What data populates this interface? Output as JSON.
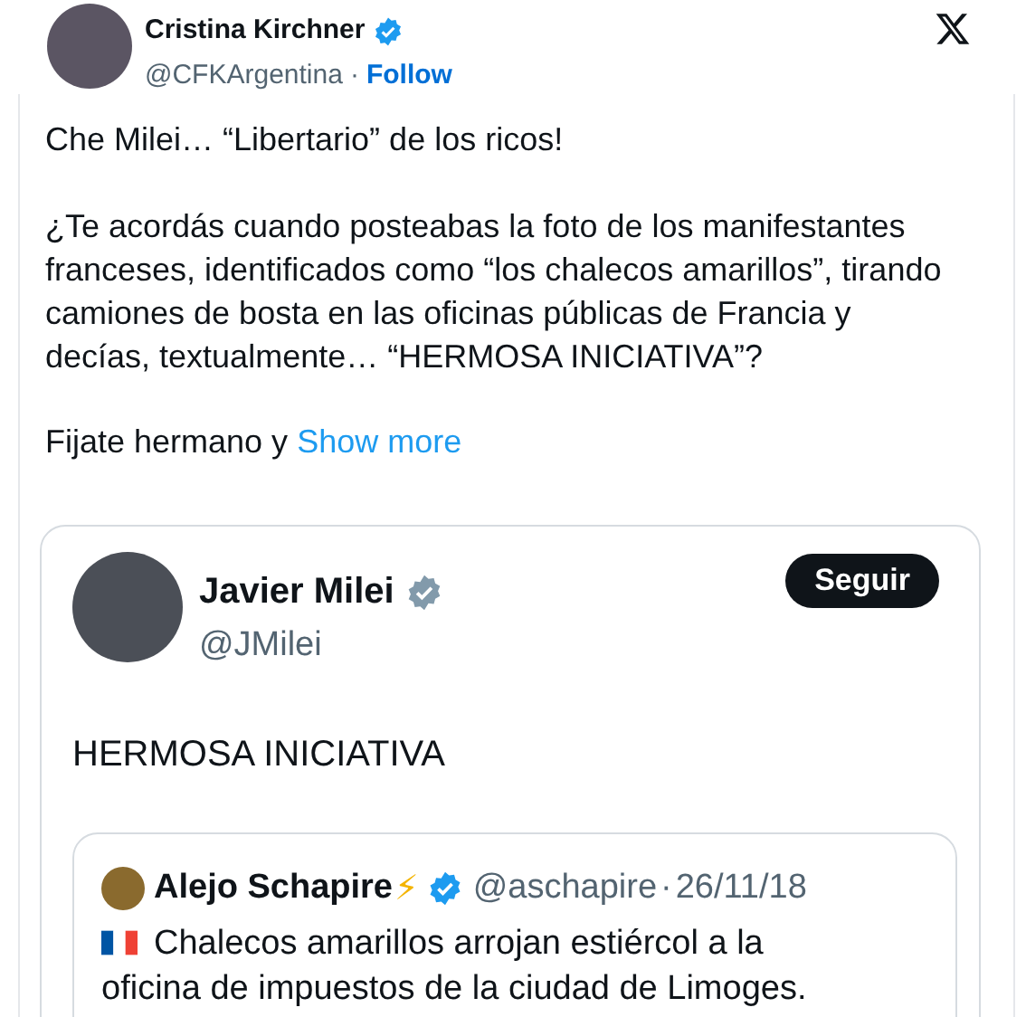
{
  "author": {
    "name": "Cristina Kirchner",
    "verified": true,
    "handle": "@CFKArgentina",
    "separator": "·",
    "follow": "Follow"
  },
  "text": [
    "Che Milei… “Libertario” de los ricos!",
    "¿Te acordás cuando posteabas la foto de los manifestantes franceses, identificados como “los chalecos amarillos”, tirando camiones de bosta en las oficinas públicas de Francia y decías, textualmente… “HERMOSA INICIATIVA”?"
  ],
  "teaser": {
    "text": "Fijate hermano y",
    "show_more": "Show more"
  },
  "embedded": {
    "author": {
      "name": "Javier Milei",
      "verified": true,
      "handle": "@JMilei"
    },
    "follow": "Seguir",
    "text": "HERMOSA INICIATIVA",
    "quote": {
      "name": "Alejo Schapire",
      "emoji": "⚡",
      "verified": true,
      "handle": "@aschapire",
      "separator": "·",
      "date": "26/11/18",
      "lines": [
        "Chalecos amarillos arrojan estiércol a la",
        "oficina de impuestos de la ciudad de Limoges."
      ]
    }
  }
}
